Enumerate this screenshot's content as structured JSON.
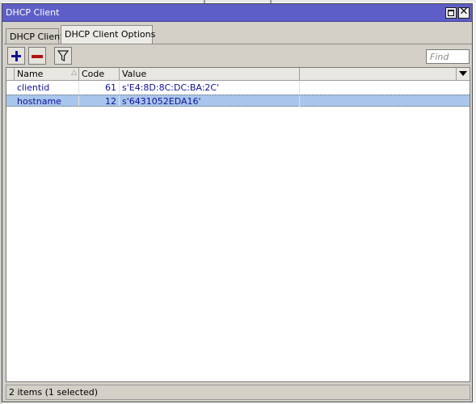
{
  "window": {
    "title": "DHCP Client"
  },
  "tabs": [
    {
      "label": "DHCP Client",
      "active": false
    },
    {
      "label": "DHCP Client Options",
      "active": true
    }
  ],
  "toolbar": {
    "add_icon": "plus-icon",
    "remove_icon": "minus-icon",
    "filter_icon": "filter-funnel-icon",
    "find_placeholder": "Find"
  },
  "table": {
    "columns": [
      "Name",
      "Code",
      "Value"
    ],
    "rows": [
      {
        "name": "clientid",
        "code": "61",
        "value": "s'E4:8D:8C:DC:BA:2C'",
        "selected": false
      },
      {
        "name": "hostname",
        "code": "12",
        "value": "s'6431052EDA16'",
        "selected": true
      }
    ]
  },
  "status": {
    "text": "2 items (1 selected)"
  },
  "colors": {
    "titlebar": "#5e5ec8",
    "row_text": "#10109a",
    "selected_row": "#a8c6ec",
    "add_icon": "#13139a",
    "remove_icon": "#b31212"
  }
}
